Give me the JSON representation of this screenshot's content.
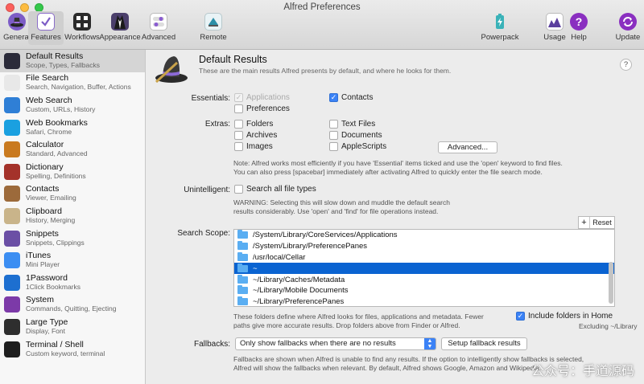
{
  "window": {
    "title": "Alfred Preferences"
  },
  "toolbar": {
    "items": [
      {
        "label": "General"
      },
      {
        "label": "Features"
      },
      {
        "label": "Workflows"
      },
      {
        "label": "Appearance"
      },
      {
        "label": "Advanced"
      },
      {
        "label": "Remote"
      },
      {
        "label": "Powerpack"
      },
      {
        "label": "Usage"
      },
      {
        "label": "Help"
      },
      {
        "label": "Update"
      }
    ]
  },
  "sidebar": {
    "items": [
      {
        "title": "Default Results",
        "subtitle": "Scope, Types, Fallbacks",
        "icon": "hat-icon",
        "color": "#2b2b3a"
      },
      {
        "title": "File Search",
        "subtitle": "Search, Navigation, Buffer, Actions",
        "icon": "magnifier-icon",
        "color": "#e8e8e8"
      },
      {
        "title": "Web Search",
        "subtitle": "Custom, URLs, History",
        "icon": "globe-icon",
        "color": "#2f7fd6"
      },
      {
        "title": "Web Bookmarks",
        "subtitle": "Safari, Chrome",
        "icon": "compass-icon",
        "color": "#1aa0e0"
      },
      {
        "title": "Calculator",
        "subtitle": "Standard, Advanced",
        "icon": "calculator-icon",
        "color": "#c97a1f"
      },
      {
        "title": "Dictionary",
        "subtitle": "Spelling, Definitions",
        "icon": "dictionary-icon",
        "color": "#a4322a"
      },
      {
        "title": "Contacts",
        "subtitle": "Viewer, Emailing",
        "icon": "contacts-icon",
        "color": "#9c6a3b"
      },
      {
        "title": "Clipboard",
        "subtitle": "History, Merging",
        "icon": "clipboard-icon",
        "color": "#c9b48a"
      },
      {
        "title": "Snippets",
        "subtitle": "Snippets, Clippings",
        "icon": "snippets-icon",
        "color": "#6b4fa5"
      },
      {
        "title": "iTunes",
        "subtitle": "Mini Player",
        "icon": "music-icon",
        "color": "#3c8ef2"
      },
      {
        "title": "1Password",
        "subtitle": "1Click Bookmarks",
        "icon": "1password-icon",
        "color": "#1d6fd0"
      },
      {
        "title": "System",
        "subtitle": "Commands, Quitting, Ejecting",
        "icon": "power-icon",
        "color": "#7c3aa8"
      },
      {
        "title": "Large Type",
        "subtitle": "Display, Font",
        "icon": "large-type-icon",
        "color": "#2e2e2e"
      },
      {
        "title": "Terminal / Shell",
        "subtitle": "Custom keyword, terminal",
        "icon": "terminal-icon",
        "color": "#1e1e1e"
      }
    ]
  },
  "header": {
    "title": "Default Results",
    "subtitle": "These are the main results Alfred presents by default, and where he looks for them.",
    "help": "?"
  },
  "essentials": {
    "label": "Essentials:",
    "applications": "Applications",
    "contacts": "Contacts",
    "preferences": "Preferences"
  },
  "extras": {
    "label": "Extras:",
    "folders": "Folders",
    "text_files": "Text Files",
    "archives": "Archives",
    "documents": "Documents",
    "images": "Images",
    "applescripts": "AppleScripts",
    "advanced_button": "Advanced..."
  },
  "note_essentials": {
    "line1": "Note: Alfred works most efficiently if you have 'Essential' items ticked and use the 'open' keyword to find files.",
    "line2": "You can also press [spacebar] immediately after activating Alfred to quickly enter the file search mode."
  },
  "unintelligent": {
    "label": "Unintelligent:",
    "checkbox": "Search all file types",
    "warn1": "WARNING: Selecting this will slow down and muddle the default search",
    "warn2": "results considerably. Use 'open' and 'find' for file operations instead."
  },
  "scope": {
    "label": "Search Scope:",
    "add": "+",
    "reset": "Reset",
    "paths": [
      "/System/Library/CoreServices/Applications",
      "/System/Library/PreferencePanes",
      "/usr/local/Cellar",
      "~",
      "~/Library/Caches/Metadata",
      "~/Library/Mobile Documents",
      "~/Library/PreferencePanes"
    ],
    "note1": "These folders define where Alfred looks for files, applications and metadata. Fewer",
    "note2": "paths give more accurate results. Drop folders above from Finder or Alfred.",
    "include_home": "Include folders in Home",
    "excluding": "Excluding ~/Library"
  },
  "fallbacks": {
    "label": "Fallbacks:",
    "select_value": "Only show fallbacks when there are no results",
    "setup_button": "Setup fallback results",
    "note1": "Fallbacks are shown when Alfred is unable to find any results. If the option to intelligently show fallbacks is selected,",
    "note2": "Alfred will show the fallbacks when relevant. By default, Alfred shows Google, Amazon and Wikipedia."
  },
  "watermark": "公众号：手道源码"
}
